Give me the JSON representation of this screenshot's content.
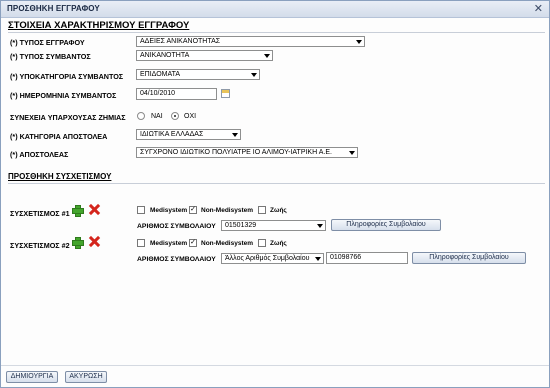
{
  "window": {
    "title": "ΠΡΟΣΘΗΚΗ ΕΓΓΡΑΦΟΥ",
    "close_symbol": "✕"
  },
  "doc_section": {
    "title": "ΣΤΟΙΧΕΙΑ ΧΑΡΑΚΤΗΡΙΣΜΟΥ ΕΓΓΡΑΦΟΥ",
    "doc_type_label": "(*) ΤΥΠΟΣ ΕΓΓΡΑΦΟΥ",
    "doc_type_value": "ΑΔΕΙΕΣ ΑΝΙΚΑΝΟΤΗΤΑΣ",
    "event_type_label": "(*) ΤΥΠΟΣ ΣΥΜΒΑΝΤΟΣ",
    "event_type_value": "ΑΝΙΚΑΝΟΤΗΤΑ",
    "subcategory_label": "(*) ΥΠΟΚΑΤΗΓΟΡΙΑ ΣΥΜΒΑΝΤΟΣ",
    "subcategory_value": "ΕΠΙΔΟΜΑΤΑ",
    "date_label": "(*) ΗΜΕΡΟΜΗΝΙΑ ΣΥΜΒΑΝΤΟΣ",
    "date_value": "04/10/2010",
    "damage_label": "ΣΥΝΕΧΕΙΑ ΥΠΑΡΧΟΥΣΑΣ ΖΗΜΙΑΣ",
    "damage_yes": "ΝΑΙ",
    "damage_no": "ΟΧΙ",
    "damage_selected": "ΟΧΙ",
    "sender_category_label": "(*) ΚΑΤΗΓΟΡΙΑ ΑΠΟΣΤΟΛΕΑ",
    "sender_category_value": "ΙΔΙΩΤΙΚΑ ΕΛΛΑΔΑΣ",
    "sender_label": "(*) ΑΠΟΣΤΟΛΕΑΣ",
    "sender_value": "ΣΥΓΧΡΟΝΟ ΙΔΙΩΤΙΚΟ ΠΟΛΥΙΑΤΡΕ ΙΟ ΑΛΙΜΟΥ-ΙΑΤΡΙΚΗ Α.Ε."
  },
  "link_section": {
    "title": "ΠΡΟΣΘΗΚΗ ΣΥΣΧΕΤΙΣΜΟΥ",
    "links": [
      {
        "label": "ΣΥΣΧΕΤΙΣΜΟΣ #1",
        "opt_medisystem": "Medisystem",
        "opt_non_medisystem": "Non-Medisystem",
        "opt_life": "Ζωής",
        "checked": [
          "Non-Medisystem"
        ],
        "contract_label": "ΑΡΙΘΜΟΣ ΣΥΜΒΟΛΑΙΟΥ",
        "contract_select": "01501329",
        "contract_text": "",
        "info_button": "Πληροφορίες Συμβολαίου"
      },
      {
        "label": "ΣΥΣΧΕΤΙΣΜΟΣ #2",
        "opt_medisystem": "Medisystem",
        "opt_non_medisystem": "Non-Medisystem",
        "opt_life": "Ζωής",
        "checked": [
          "Non-Medisystem"
        ],
        "contract_label": "ΑΡΙΘΜΟΣ ΣΥΜΒΟΛΑΙΟΥ",
        "contract_select": "Άλλος Αριθμός Συμβολαίου",
        "contract_text": "01098766",
        "info_button": "Πληροφορίες Συμβολαίου"
      }
    ]
  },
  "footer": {
    "create_button": "ΔΗΜΙΟΥΡΓΙΑ",
    "cancel_button": "ΑΚΥΡΩΣΗ"
  },
  "check_mark": "✓"
}
